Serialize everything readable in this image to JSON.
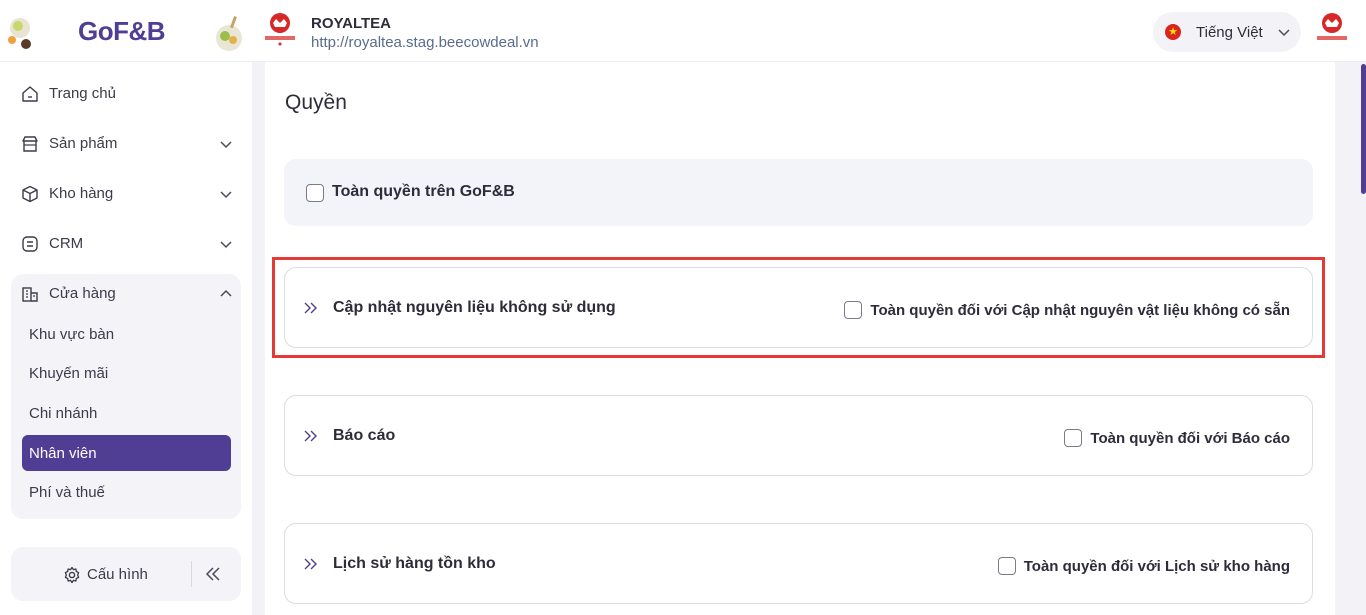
{
  "brand": {
    "name": "GoF&B"
  },
  "store": {
    "name": "ROYALTEA",
    "url": "http://royaltea.stag.beecowdeal.vn"
  },
  "language": {
    "label": "Tiếng Việt",
    "flag_color": "#da251d"
  },
  "sidebar": {
    "items": [
      {
        "label": "Trang chủ",
        "icon": "home-icon"
      },
      {
        "label": "Sản phẩm",
        "icon": "shop-icon"
      },
      {
        "label": "Kho hàng",
        "icon": "box-icon"
      },
      {
        "label": "CRM",
        "icon": "crm-icon"
      },
      {
        "label": "Cửa hàng",
        "icon": "store-icon"
      }
    ],
    "store_sub": [
      {
        "label": "Khu vực bàn"
      },
      {
        "label": "Khuyến mãi"
      },
      {
        "label": "Chi nhánh"
      },
      {
        "label": "Nhân viên",
        "active": true
      },
      {
        "label": "Phí và thuế"
      }
    ],
    "config_label": "Cấu hình"
  },
  "main": {
    "title": "Quyền",
    "full_access_label": "Toàn quyền trên GoF&B",
    "permissions": [
      {
        "title": "Cập nhật nguyên liệu không sử dụng",
        "full_label": "Toàn quyền đối với Cập nhật nguyên vật liệu không có sẵn",
        "highlighted": true
      },
      {
        "title": "Báo cáo",
        "full_label": "Toàn quyền đối với Báo cáo"
      },
      {
        "title": "Lịch sử hàng tồn kho",
        "full_label": "Toàn quyền đối với Lịch sử kho hàng"
      }
    ]
  },
  "colors": {
    "brand": "#4f3e94",
    "highlight": "#e53935"
  }
}
